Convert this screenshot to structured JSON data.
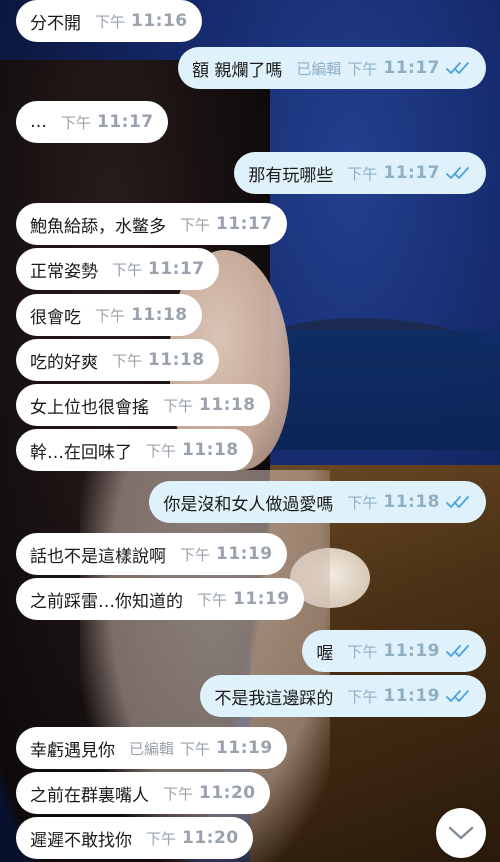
{
  "accent_color": "#4aa3df",
  "bubble_in_color": "#ffffff",
  "bubble_out_color": "#dff1fb",
  "messages": [
    {
      "dir": "in",
      "text": "分不開",
      "edited": "",
      "ampm": "下午",
      "time": "11:16"
    },
    {
      "dir": "out",
      "text": "額 親爛了嗎",
      "edited": "已編輯",
      "ampm": "下午",
      "time": "11:17"
    },
    {
      "dir": "in",
      "text": "…",
      "edited": "",
      "ampm": "下午",
      "time": "11:17"
    },
    {
      "dir": "out",
      "text": "那有玩哪些",
      "edited": "",
      "ampm": "下午",
      "time": "11:17"
    },
    {
      "dir": "in",
      "text": "鮑魚給舔，水鳖多",
      "edited": "",
      "ampm": "下午",
      "time": "11:17"
    },
    {
      "dir": "in",
      "text": "正常姿勢",
      "edited": "",
      "ampm": "下午",
      "time": "11:17"
    },
    {
      "dir": "in",
      "text": "很會吃",
      "edited": "",
      "ampm": "下午",
      "time": "11:18"
    },
    {
      "dir": "in",
      "text": "吃的好爽",
      "edited": "",
      "ampm": "下午",
      "time": "11:18"
    },
    {
      "dir": "in",
      "text": "女上位也很會搖",
      "edited": "",
      "ampm": "下午",
      "time": "11:18"
    },
    {
      "dir": "in",
      "text": "幹…在回味了",
      "edited": "",
      "ampm": "下午",
      "time": "11:18"
    },
    {
      "dir": "out",
      "text": "你是沒和女人做過愛嗎",
      "edited": "",
      "ampm": "下午",
      "time": "11:18"
    },
    {
      "dir": "in",
      "text": "話也不是這樣說啊",
      "edited": "",
      "ampm": "下午",
      "time": "11:19"
    },
    {
      "dir": "in",
      "text": "之前踩雷…你知道的",
      "edited": "",
      "ampm": "下午",
      "time": "11:19"
    },
    {
      "dir": "out",
      "text": "喔",
      "edited": "",
      "ampm": "下午",
      "time": "11:19"
    },
    {
      "dir": "out",
      "text": "不是我這邊踩的",
      "edited": "",
      "ampm": "下午",
      "time": "11:19"
    },
    {
      "dir": "in",
      "text": "幸虧遇見你",
      "edited": "已編輯",
      "ampm": "下午",
      "time": "11:19"
    },
    {
      "dir": "in",
      "text": "之前在群裏嘴人",
      "edited": "",
      "ampm": "下午",
      "time": "11:20"
    },
    {
      "dir": "in",
      "text": "遲遲不敢找你",
      "edited": "",
      "ampm": "下午",
      "time": "11:20"
    }
  ],
  "scroll_button_icon": "chevron-down-icon"
}
